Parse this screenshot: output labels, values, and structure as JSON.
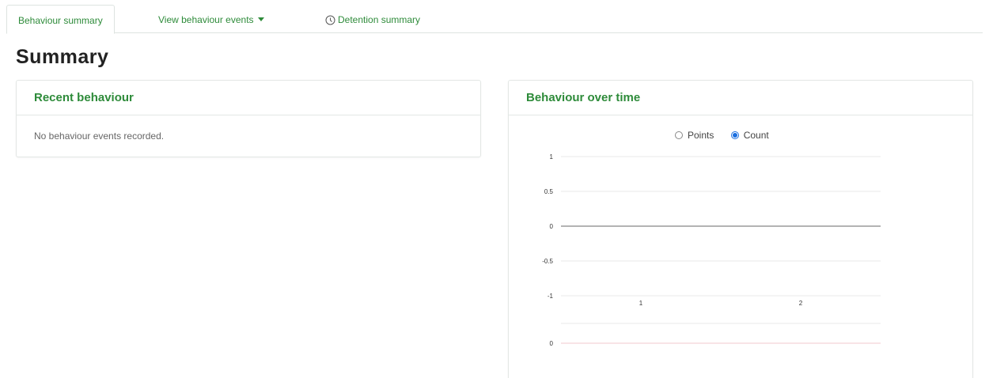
{
  "tabs": [
    {
      "label": "Behaviour summary",
      "active": true
    },
    {
      "label": "View behaviour events",
      "has_dropdown": true
    },
    {
      "label": "Detention summary",
      "icon": "clock-icon"
    }
  ],
  "page_title": "Summary",
  "recent_behaviour": {
    "title": "Recent behaviour",
    "empty_message": "No behaviour events recorded."
  },
  "behaviour_over_time": {
    "title": "Behaviour over time",
    "view_options": [
      {
        "label": "Points",
        "checked": false
      },
      {
        "label": "Count",
        "checked": true
      }
    ]
  },
  "colors": {
    "accent_green": "#2e8b3a",
    "radio_blue": "#1a6fe0",
    "zero_line": "#9a9a9a",
    "grid": "#e8e8e8",
    "lower_line": "#f0c8cc"
  },
  "chart_data": {
    "type": "line",
    "title": "",
    "xlabel": "",
    "ylabel": "",
    "y_ticks": [
      "1",
      "0.5",
      "0",
      "-0.5",
      "-1"
    ],
    "ylim": [
      -1,
      1
    ],
    "x_categories": [
      "1",
      "2"
    ],
    "series": [
      {
        "values": [
          0,
          0
        ]
      }
    ],
    "lower_ticks": [
      "",
      "0"
    ],
    "grid": true
  }
}
